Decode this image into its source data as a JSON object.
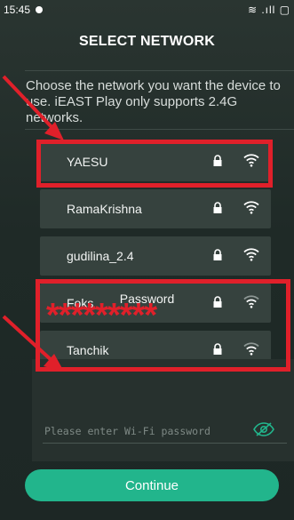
{
  "status_bar": {
    "time": "15:45",
    "icons": "≋ .ıll ▢"
  },
  "header": {
    "title": "SELECT NETWORK"
  },
  "description": "Choose the network you want the device to use. iEAST Play only supports 2.4G networks.",
  "networks": [
    {
      "name": "YAESU",
      "secured": true,
      "signal": "strong"
    },
    {
      "name": "RamaKrishna",
      "secured": true,
      "signal": "strong"
    },
    {
      "name": "gudilina_2.4",
      "secured": true,
      "signal": "strong"
    },
    {
      "name": "Foks",
      "secured": true,
      "signal": "medium"
    },
    {
      "name": "Tanchik",
      "secured": true,
      "signal": "medium"
    }
  ],
  "password": {
    "label": "Password",
    "placeholder": "Please enter Wi-Fi password",
    "value": ""
  },
  "continue_label": "Continue",
  "annotations": {
    "color": "#e0202a",
    "masked_text": "*********"
  },
  "colors": {
    "accent": "#22b58c",
    "background": "#232d2a"
  }
}
